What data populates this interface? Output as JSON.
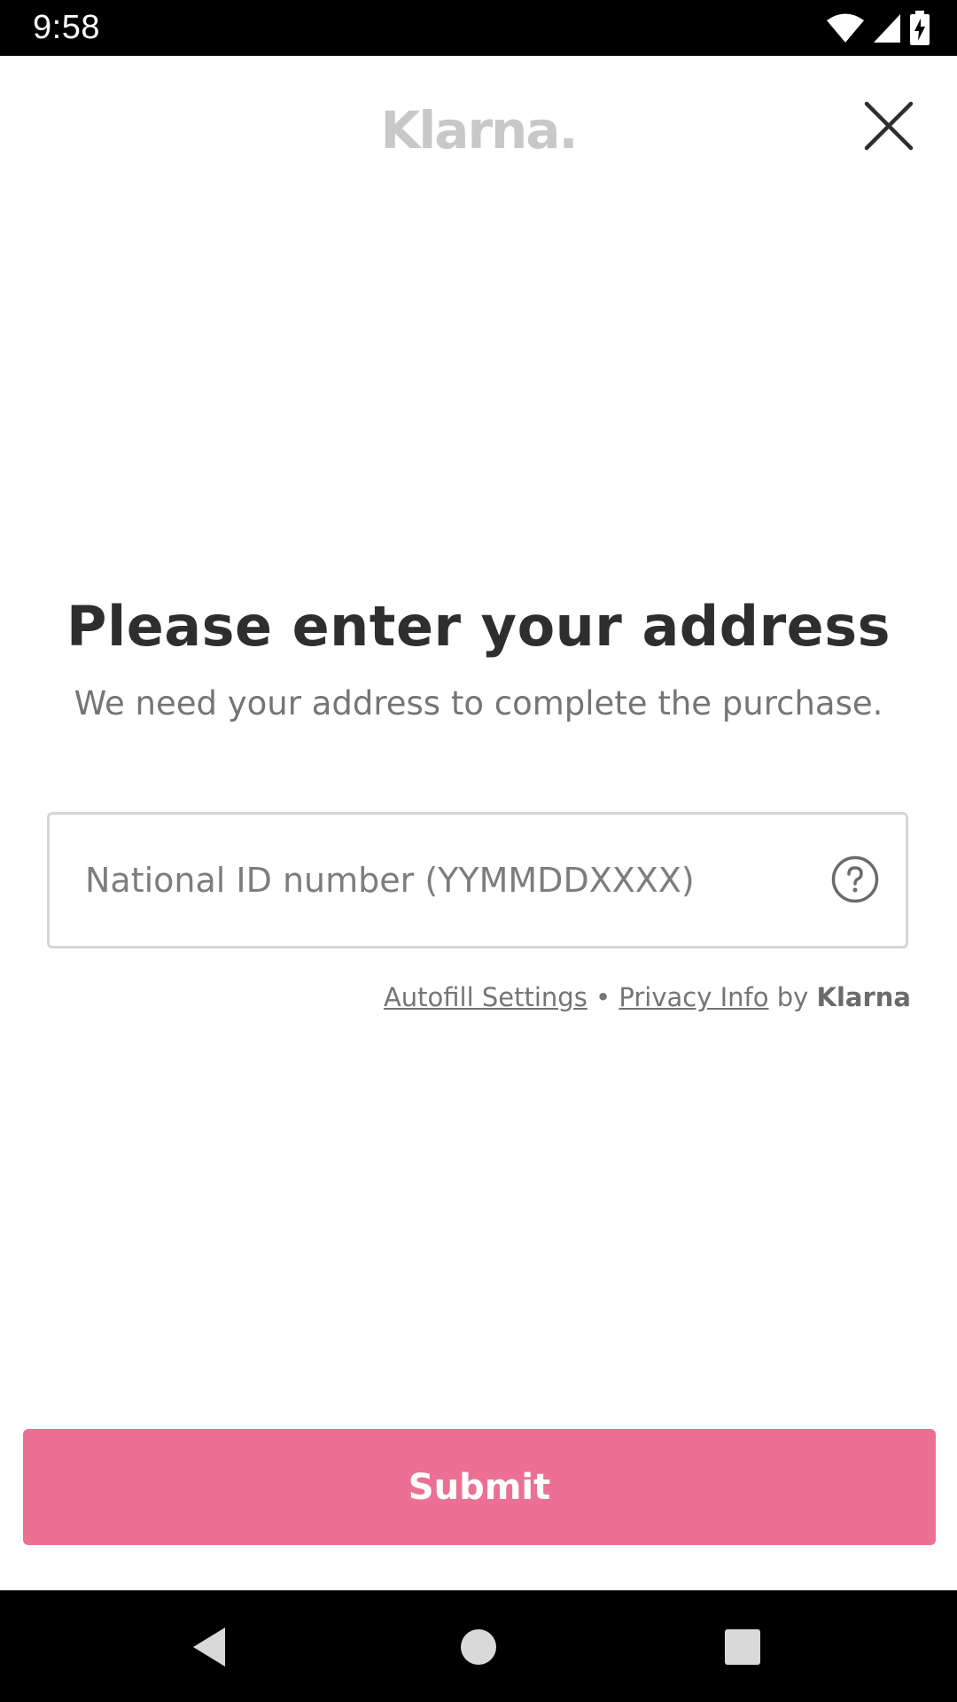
{
  "status_bar": {
    "time": "9:58",
    "icons": [
      "wifi-icon",
      "signal-icon",
      "battery-charging-icon"
    ]
  },
  "header": {
    "logo_text": "Klarna.",
    "close_icon": "close-icon"
  },
  "main": {
    "title": "Please enter your address",
    "subtitle": "We need your address to complete the purchase.",
    "national_id": {
      "placeholder": "National ID number (YYMMDDXXXX)",
      "value": "",
      "help_icon": "question-circle-icon"
    },
    "footer": {
      "autofill_label": "Autofill Settings",
      "separator": "•",
      "privacy_label": "Privacy Info",
      "by_label": "by",
      "brand": "Klarna"
    }
  },
  "submit": {
    "label": "Submit"
  },
  "colors": {
    "accent": "#eb7093",
    "title_text": "#2e2e2e",
    "secondary_text": "#757575",
    "logo": "#c8c8c8"
  },
  "nav_bar": {
    "icons": [
      "back-icon",
      "home-icon",
      "recents-icon"
    ]
  }
}
